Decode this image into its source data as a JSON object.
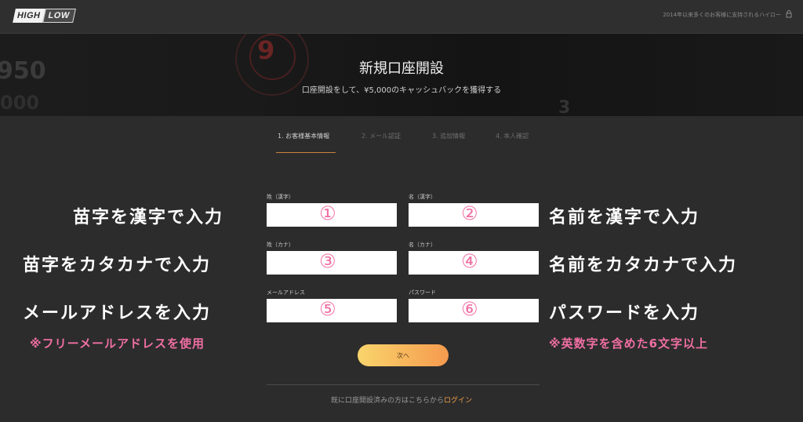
{
  "header": {
    "logo_high": "HIGH",
    "logo_low": "LOW",
    "tagline": "2014年以来多くのお客様に支持されるハイロー"
  },
  "hero": {
    "title": "新規口座開設",
    "subtitle": "口座開設をして、¥5,000のキャッシュバックを獲得する",
    "deco_numbers": [
      "9",
      "950",
      "000",
      "3"
    ]
  },
  "steps": [
    {
      "label": "1. お客様基本情報",
      "active": true
    },
    {
      "label": "2. メール認証",
      "active": false
    },
    {
      "label": "3. 追加情報",
      "active": false
    },
    {
      "label": "4. 本人確認",
      "active": false
    }
  ],
  "form": {
    "last_name_kanji_label": "姓（漢字）",
    "first_name_kanji_label": "名（漢字）",
    "last_name_kana_label": "姓（カナ）",
    "first_name_kana_label": "名（カナ）",
    "email_label": "メールアドレス",
    "password_label": "パスワード",
    "next_button": "次へ"
  },
  "annotations": {
    "num1": "①",
    "num2": "②",
    "num3": "③",
    "num4": "④",
    "num5": "⑤",
    "num6": "⑥",
    "left1": "苗字を漢字で入力",
    "right1": "名前を漢字で入力",
    "left2": "苗字をカタカナで入力",
    "right2": "名前をカタカナで入力",
    "left3": "メールアドレスを入力",
    "right3": "パスワードを入力",
    "note_left": "※フリーメールアドレスを使用",
    "note_right": "※英数字を含めた6文字以上"
  },
  "footer": {
    "text": "既に口座開設済みの方はこちらから",
    "login_link": "ログイン"
  },
  "colors": {
    "accent_pink": "#f06fa3",
    "accent_orange": "#f0a04b",
    "button_gradient_start": "#f9d56c",
    "button_gradient_end": "#f59a4e"
  }
}
